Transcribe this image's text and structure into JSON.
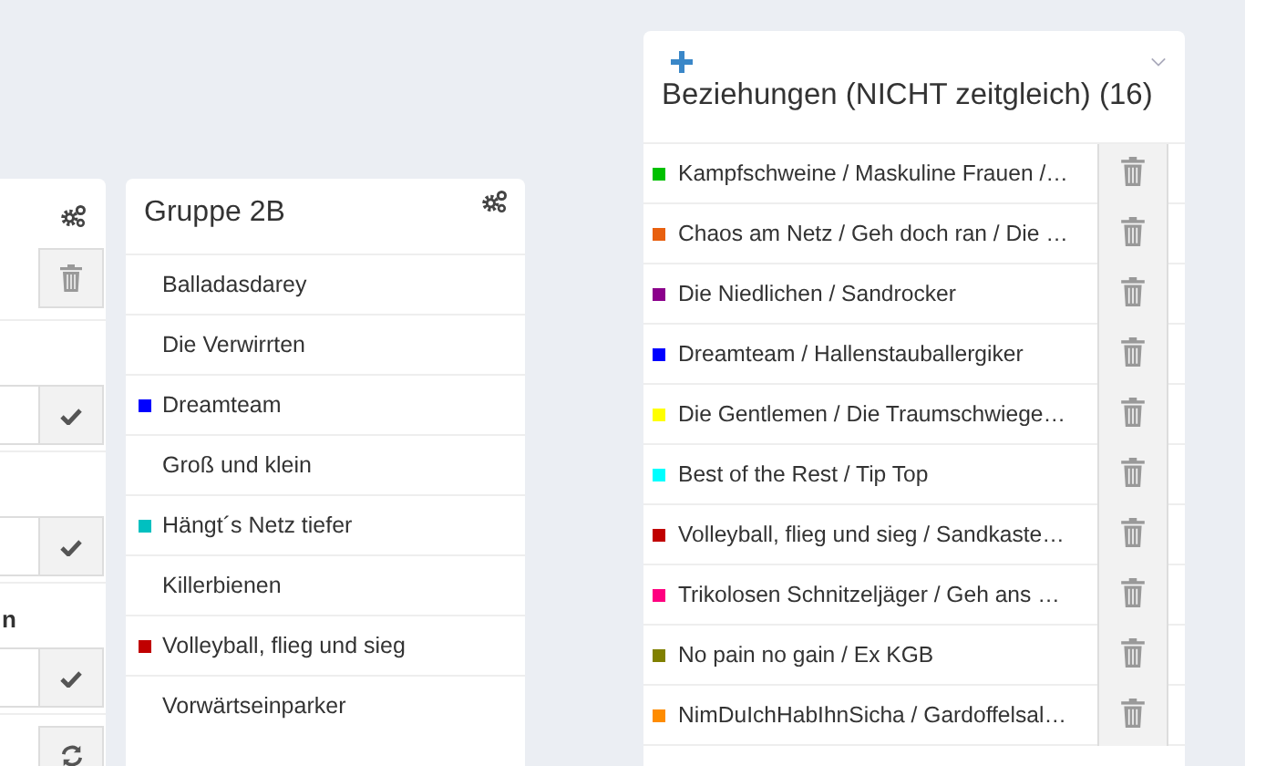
{
  "left_panel": {
    "rows": [
      {
        "kind": "delete"
      },
      {
        "kind": "confirm"
      },
      {
        "kind": "confirm"
      },
      {
        "kind": "confirm",
        "label": "n"
      },
      {
        "kind": "refresh"
      }
    ]
  },
  "group_panel": {
    "title": "Gruppe 2B",
    "teams": [
      {
        "name": "Balladasdarey"
      },
      {
        "name": "Die Verwirrten"
      },
      {
        "name": "Dreamteam",
        "color": "#0000ff"
      },
      {
        "name": "Groß und klein"
      },
      {
        "name": "Hängt´s Netz tiefer",
        "color": "#00c0c0"
      },
      {
        "name": "Killerbienen"
      },
      {
        "name": "Volleyball, flieg und sieg",
        "color": "#c00000"
      },
      {
        "name": "Vorwärtseinparker"
      }
    ]
  },
  "relations_panel": {
    "title": "Beziehungen (NICHT zeitgleich) (16)",
    "rows": [
      {
        "name": "Kampfschweine / Maskuline Frauen /…",
        "color": "#00c000"
      },
      {
        "name": "Chaos am Netz / Geh doch ran / Die …",
        "color": "#e8600f"
      },
      {
        "name": "Die Niedlichen / Sandrocker",
        "color": "#8b008b"
      },
      {
        "name": "Dreamteam / Hallenstauballergiker",
        "color": "#0000ff"
      },
      {
        "name": "Die Gentlemen / Die Traumschwiege…",
        "color": "#ffff00"
      },
      {
        "name": "Best of the Rest / Tip Top",
        "color": "#00ffff"
      },
      {
        "name": "Volleyball, flieg und sieg / Sandkaste…",
        "color": "#c00000"
      },
      {
        "name": "Trikolosen Schnitzeljäger / Geh ans …",
        "color": "#ff0080"
      },
      {
        "name": "No pain no gain / Ex KGB",
        "color": "#808000"
      },
      {
        "name": "NimDuIchHabIhnSicha / Gardoffelsal…",
        "color": "#ff8c00"
      }
    ]
  }
}
